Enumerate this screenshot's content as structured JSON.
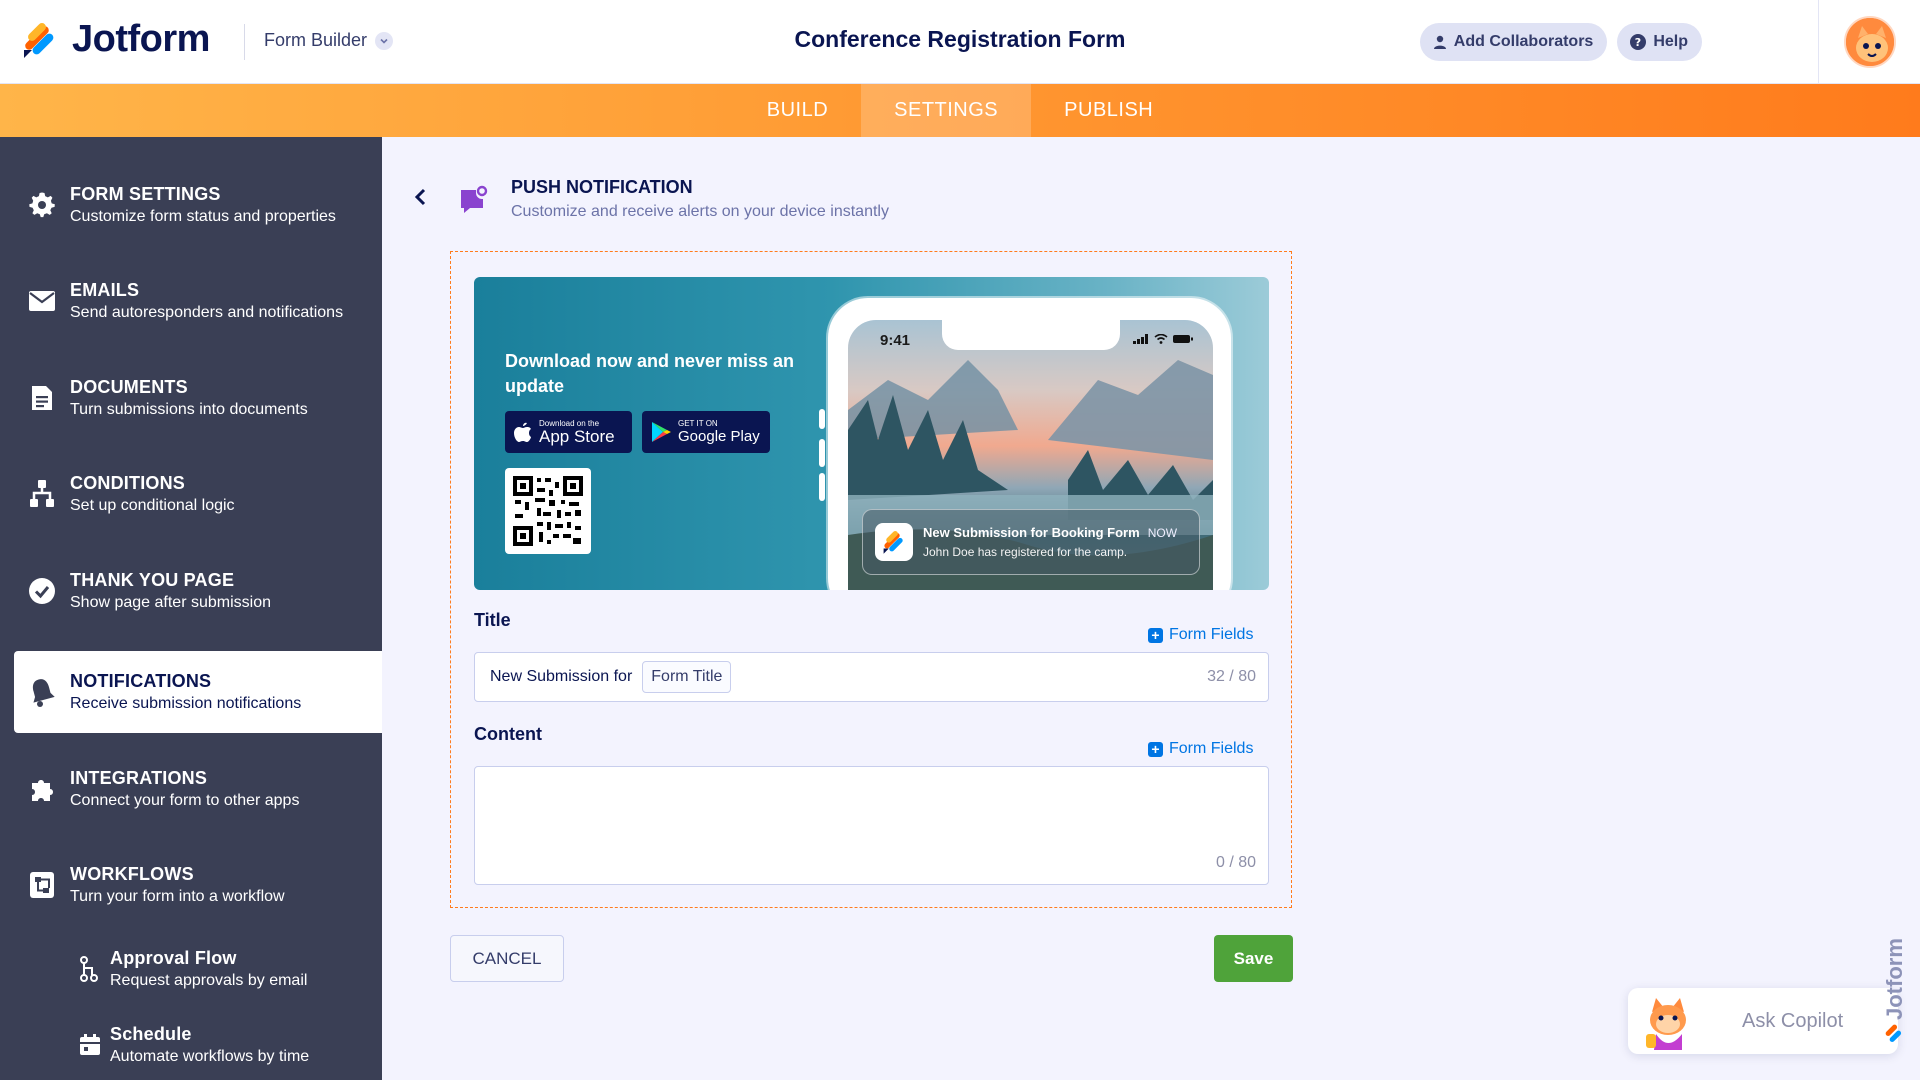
{
  "header": {
    "brand": "Jotform",
    "builder_label": "Form Builder",
    "form_title": "Conference Registration Form",
    "add_collaborators": "Add Collaborators",
    "help": "Help"
  },
  "tabs": [
    {
      "label": "BUILD",
      "active": false
    },
    {
      "label": "SETTINGS",
      "active": true
    },
    {
      "label": "PUBLISH",
      "active": false
    }
  ],
  "sidebar": {
    "items": [
      {
        "title": "FORM SETTINGS",
        "desc": "Customize form status and properties",
        "icon": "gear-icon"
      },
      {
        "title": "EMAILS",
        "desc": "Send autoresponders and notifications",
        "icon": "envelope-icon"
      },
      {
        "title": "DOCUMENTS",
        "desc": "Turn submissions into documents",
        "icon": "document-icon"
      },
      {
        "title": "CONDITIONS",
        "desc": "Set up conditional logic",
        "icon": "conditions-icon"
      },
      {
        "title": "THANK YOU PAGE",
        "desc": "Show page after submission",
        "icon": "check-circle-icon"
      },
      {
        "title": "NOTIFICATIONS",
        "desc": "Receive submission notifications",
        "icon": "bell-icon",
        "active": true
      },
      {
        "title": "INTEGRATIONS",
        "desc": "Connect your form to other apps",
        "icon": "puzzle-icon"
      },
      {
        "title": "WORKFLOWS",
        "desc": "Turn your form into a workflow",
        "icon": "workflow-icon"
      }
    ],
    "sub_items": [
      {
        "title": "Approval Flow",
        "desc": "Request approvals by email",
        "icon": "approval-flow-icon"
      },
      {
        "title": "Schedule",
        "desc": "Automate workflows by time",
        "icon": "calendar-icon"
      }
    ]
  },
  "page": {
    "title": "PUSH NOTIFICATION",
    "subtitle": "Customize and receive alerts on your device instantly"
  },
  "promo": {
    "headline": "Download now and never miss an update",
    "app_store_small": "Download on the",
    "app_store_big": "App Store",
    "google_play_small": "GET IT ON",
    "google_play_big": "Google Play",
    "phone_time": "9:41",
    "notif_title": "New Submission for Booking Form",
    "notif_time": "NOW",
    "notif_body": "John Doe has registered for the camp."
  },
  "title_field": {
    "label": "Title",
    "form_fields": "Form Fields",
    "prefix_text": "New Submission for",
    "tag": "Form Title",
    "counter": "32 / 80"
  },
  "content_field": {
    "label": "Content",
    "form_fields": "Form Fields",
    "counter": "0 / 80"
  },
  "actions": {
    "cancel": "CANCEL",
    "save": "Save"
  },
  "copilot": {
    "label": "Ask Copilot"
  },
  "colors": {
    "accent_orange": "#ff7b1c",
    "sidebar_bg": "#3a3f55",
    "save_green": "#4fa33a",
    "link_blue": "#0075e3"
  }
}
